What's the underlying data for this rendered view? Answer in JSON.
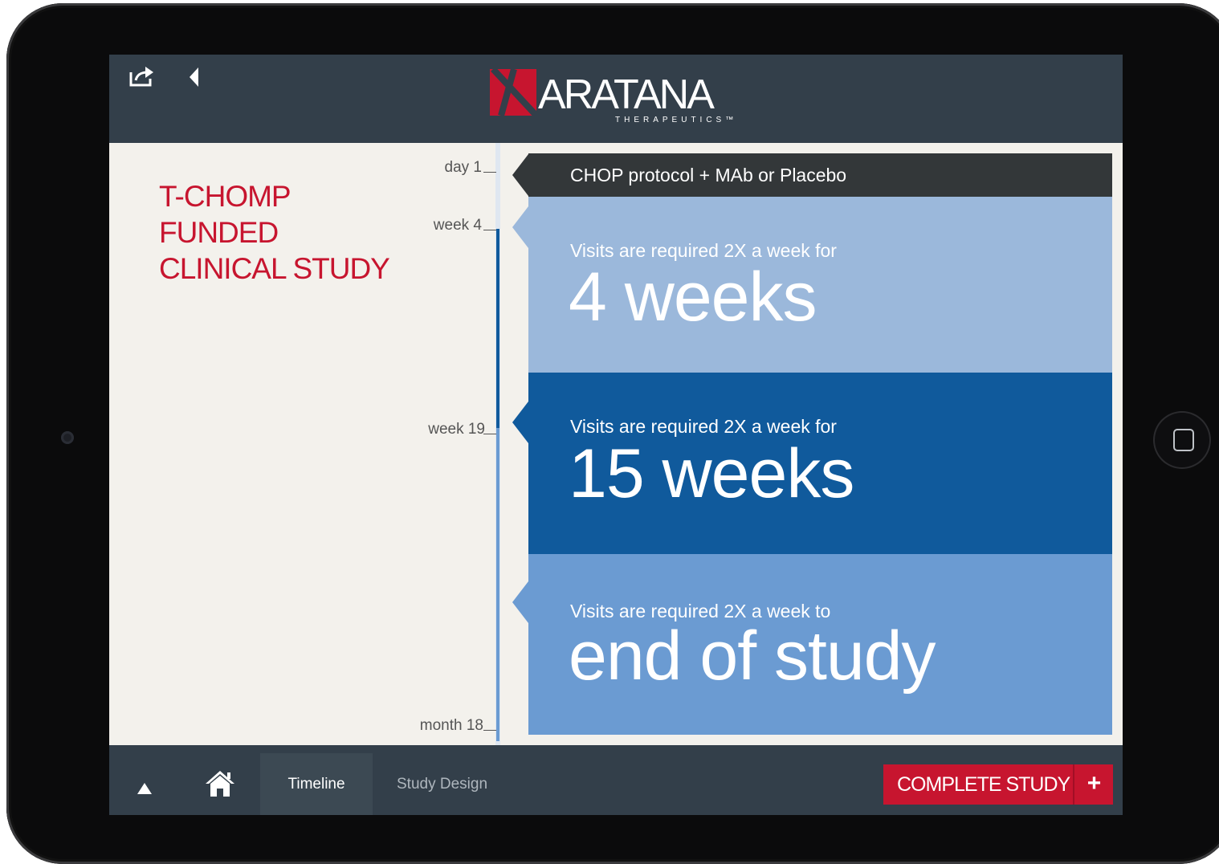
{
  "header": {
    "logo_text": "ARATANA",
    "logo_subtext": "THERAPEUTICS™"
  },
  "study": {
    "title_lines": [
      "T-CHOMP",
      "FUNDED",
      "CLINICAL STUDY"
    ]
  },
  "timeline": {
    "markers": [
      "day 1",
      "week 4",
      "week 19",
      "month 18"
    ]
  },
  "panels": {
    "protocol": "CHOP protocol + MAb or Placebo",
    "phase1": {
      "sub": "Visits are required 2X a week for",
      "big": "4 weeks"
    },
    "phase2": {
      "sub": "Visits are required 2X a week for",
      "big": "15 weeks"
    },
    "phase3": {
      "sub": "Visits are required 2X a week to",
      "big": "end of study"
    }
  },
  "bottom_nav": {
    "tab_timeline": "Timeline",
    "tab_study_design": "Study Design",
    "complete_button": "COMPLETE STUDY",
    "complete_plus": "+"
  },
  "colors": {
    "brand_red": "#c7152f",
    "bar_dark": "#333f4a",
    "phase1": "#9bb8db",
    "phase2": "#105a9c",
    "phase3": "#6b9bd2"
  },
  "icons": [
    "share-icon",
    "back-icon",
    "up-arrow-icon",
    "home-icon"
  ]
}
